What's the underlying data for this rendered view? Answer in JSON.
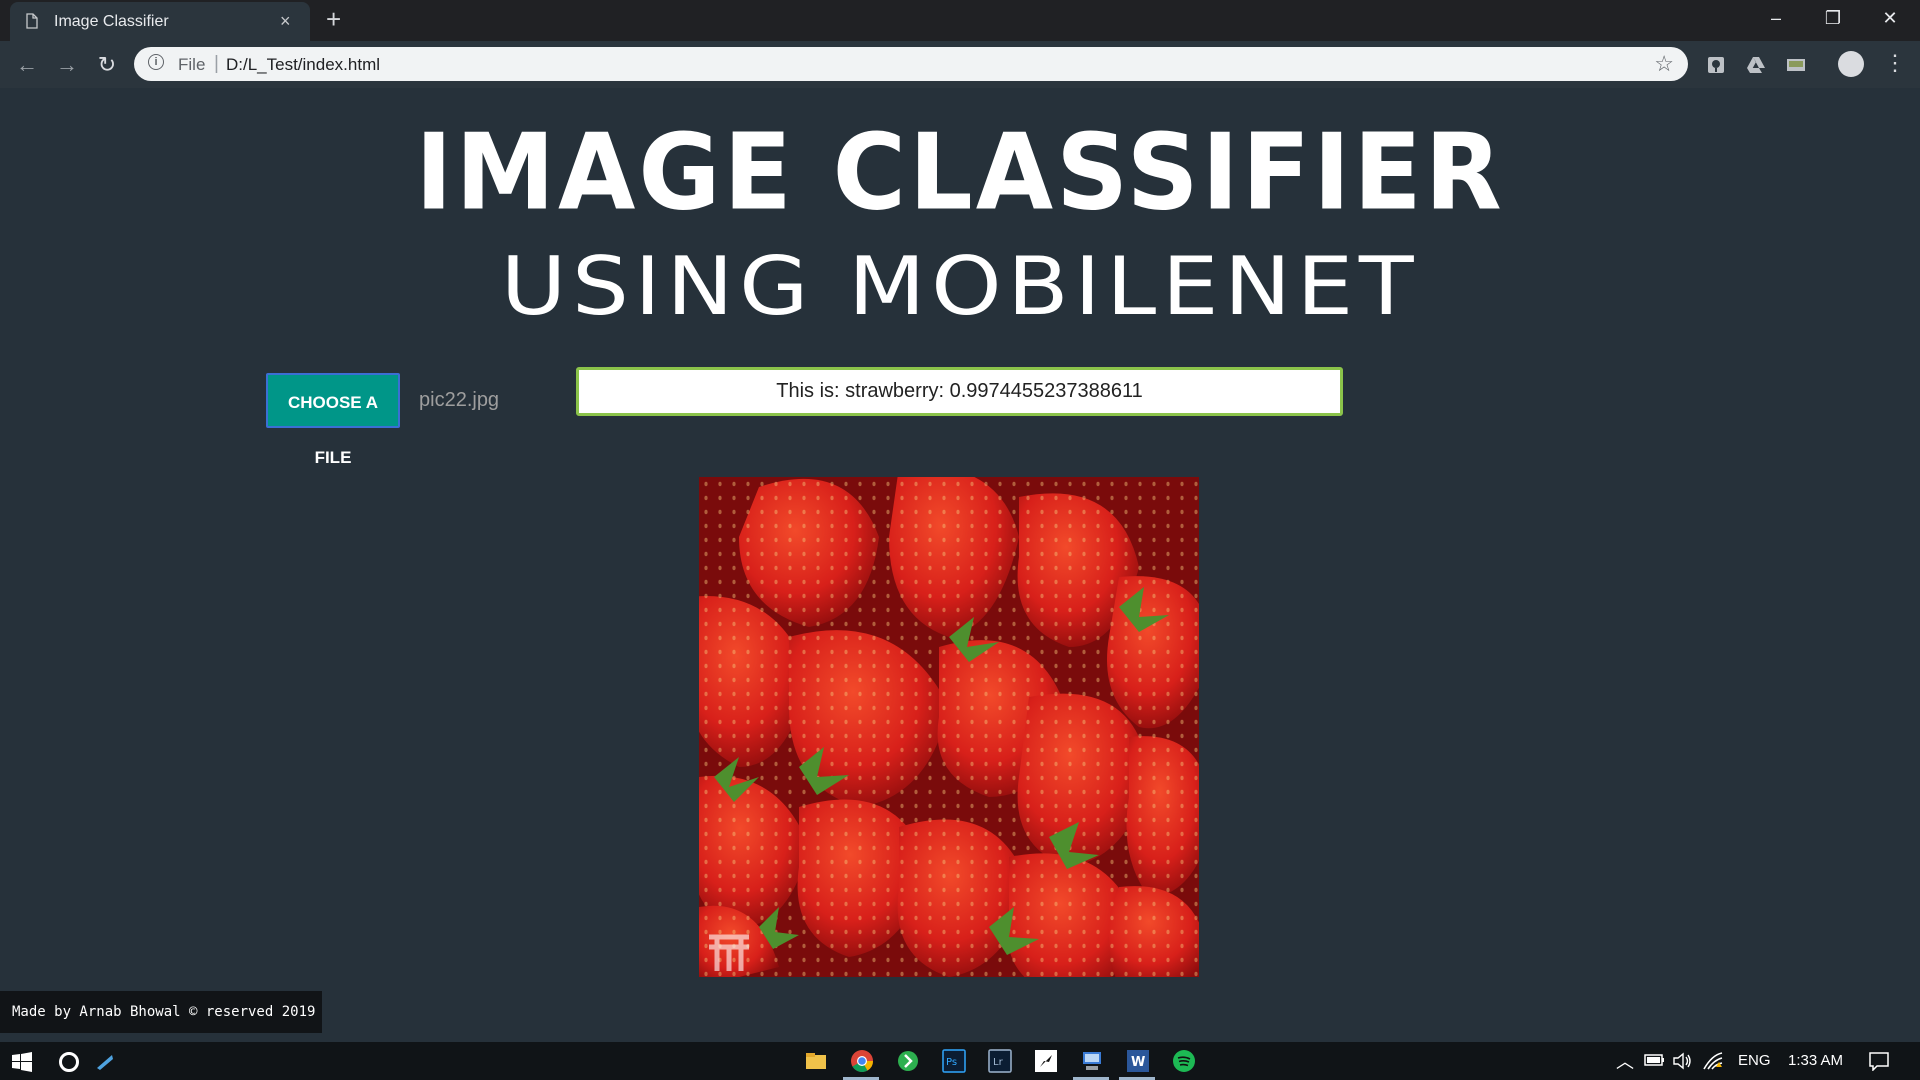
{
  "browser": {
    "tab_title": "Image Classifier",
    "tab_close": "×",
    "new_tab": "+",
    "url_scheme": "File",
    "url_separator": "|",
    "url_path": "D:/L_Test/index.html",
    "window_controls": {
      "minimize": "–",
      "restore": "❐",
      "close": "✕"
    }
  },
  "page": {
    "title": "IMAGE CLASSIFIER",
    "subtitle": "USING MOBILENET",
    "choose_button": "CHOOSE A FILE",
    "file_name": "pic22.jpg",
    "result_text": "This is: strawberry: 0.9974455237388611",
    "footer": "Made by Arnab Bhowal © reserved 2019"
  },
  "taskbar": {
    "language": "ENG",
    "time": "1:33 AM"
  },
  "colors": {
    "page_bg": "#26313a",
    "button_bg": "#009688",
    "result_border": "#8bc34a"
  },
  "icons": [
    "document-icon",
    "back-icon",
    "forward-icon",
    "reload-icon",
    "info-icon",
    "star-icon",
    "extension-icon",
    "profile-icon",
    "menu-icon",
    "windows-start-icon",
    "cortana-icon",
    "file-explorer-icon",
    "chrome-icon",
    "photoshop-icon",
    "lightroom-icon",
    "word-icon",
    "spotify-icon"
  ]
}
